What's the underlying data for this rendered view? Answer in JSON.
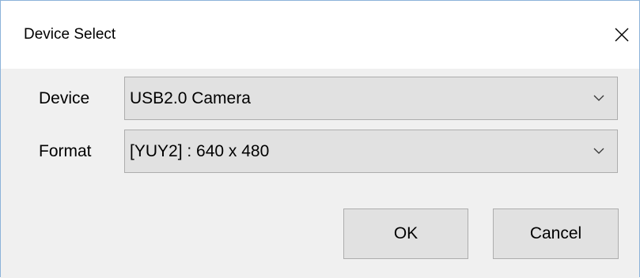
{
  "window": {
    "title": "Device Select",
    "close_icon": "close-icon"
  },
  "device": {
    "label": "Device",
    "selected": "USB2.0 Camera",
    "arrow_icon": "chevron-down-icon"
  },
  "format": {
    "label": "Format",
    "selected": "[YUY2] : 640 x 480",
    "arrow_icon": "chevron-down-icon"
  },
  "buttons": {
    "ok_label": "OK",
    "cancel_label": "Cancel"
  },
  "colors": {
    "window_border": "#8cb3d9",
    "client_background": "#f0f0f0",
    "control_background": "#e1e1e1",
    "control_border": "#adadad"
  }
}
